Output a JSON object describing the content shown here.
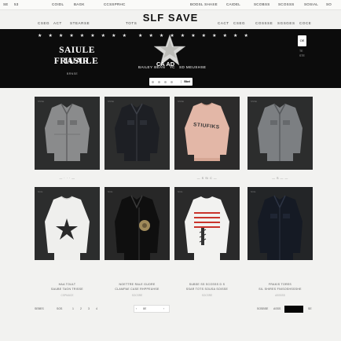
{
  "topbar": {
    "left": [
      "SE",
      "53"
    ],
    "items": [
      "COIDL",
      "BAGK",
      "CCSSPRHC",
      "BODSL SHASE",
      "CAIDEL",
      "SCOBSS",
      "SCOSSS",
      "SOSIAL",
      "SO"
    ]
  },
  "brand": "SLF SAVE",
  "nav": {
    "left": [
      "CSEG",
      "ACT",
      "STEARSE"
    ],
    "center": "TOTS",
    "right": [
      "CACT",
      "CSEG",
      "COSSSE",
      "SGSGES",
      "COCE"
    ]
  },
  "hero": {
    "headline_1": "SAIULE IUAR",
    "headline_2": "FRASLLE",
    "tag": "BRNSE",
    "center_title": "CA AD",
    "subtitle": "BAILEY BEAN",
    "subtitle_2": "YC",
    "subtitle_3": "SD MEUSHSE",
    "cta_label": "Bbel",
    "side_label": "OE",
    "side_text": [
      "TE",
      "STE"
    ]
  },
  "products_row1": [
    {
      "tag": "SSSE",
      "name": "denim-jacket",
      "caption": "— · · · —"
    },
    {
      "tag": "SSSE",
      "name": "dark-jacket",
      "caption": ""
    },
    {
      "tag": "SSSE",
      "name": "pink-sweater",
      "caption": "— S Si C —",
      "print": "STIUFIKS"
    },
    {
      "tag": "SSSE",
      "name": "denim-jacket-2",
      "caption": "— S — —"
    }
  ],
  "products_row2": [
    {
      "tag": "NCE",
      "name": "white-star-sweater",
      "title": "HAA TOULT",
      "subtitle": "SAUBE TAON TRISSE",
      "price": "CSPMUCE"
    },
    {
      "tag": "NCE",
      "name": "leather-jacket",
      "title": "NOETTRE RALE GUORE",
      "subtitle": "CLAMPAE CASE RHPPEUHSE",
      "price": "SOCSRE"
    },
    {
      "tag": "NCE",
      "name": "striped-sweater",
      "title": "SUBSE SS SCOSSS D S",
      "subtitle": "SSAR TOTS SOUSA SOISSE",
      "price": "SOCSRE"
    },
    {
      "tag": "NCE",
      "name": "dark-denim-jacket",
      "title": "FRAKIS TORES",
      "subtitle": "SIL SHIRES FNISOSHSSSHE",
      "price": "ASSSSS"
    }
  ],
  "footer": {
    "left": [
      "SEBES",
      "SOS"
    ],
    "pages": [
      "1",
      "2",
      "3",
      "4"
    ],
    "center": [
      "‹",
      "8E",
      "›"
    ],
    "right": [
      "SOSBSE",
      "ASSS",
      "SOI",
      "SE"
    ]
  },
  "colors": {
    "hero_bg": "#0c0c0c",
    "page_bg": "#f2f2f0",
    "card_bg": "#2c2d2d",
    "pink": "#e3b7a7",
    "red_stripe": "#c9342c"
  }
}
